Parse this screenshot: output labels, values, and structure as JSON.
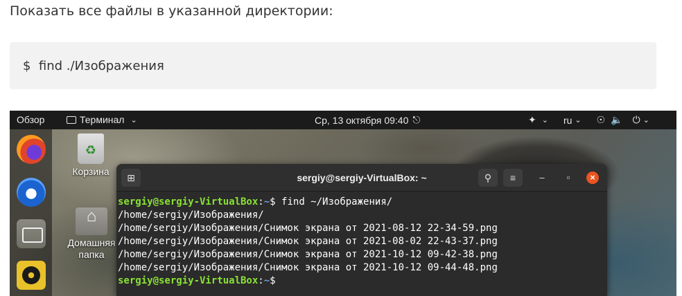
{
  "article": {
    "intro": "Показать все файлы в указанной директории:",
    "code": "$  find ./Изображения"
  },
  "topbar": {
    "overview": "Обзор",
    "app_name": "Терминал",
    "clock": "Ср, 13 октября  09:40",
    "lang": "ru"
  },
  "desktop": {
    "trash_label": "Корзина",
    "home_label": "Домашняя папка"
  },
  "terminal": {
    "title": "sergiy@sergiy-VirtualBox: ~",
    "prompt_user": "sergiy@sergiy-VirtualBox",
    "prompt_sep": ":",
    "prompt_path": "~",
    "prompt_end": "$ ",
    "command": "find ~/Изображения/",
    "output": [
      "/home/sergiy/Изображения/",
      "/home/sergiy/Изображения/Снимок экрана от 2021-08-12 22-34-59.png",
      "/home/sergiy/Изображения/Снимок экрана от 2021-08-02 22-43-37.png",
      "/home/sergiy/Изображения/Снимок экрана от 2021-10-12 09-42-38.png",
      "/home/sergiy/Изображения/Снимок экрана от 2021-10-12 09-44-48.png"
    ]
  },
  "colors": {
    "prompt_green": "#8ae234",
    "path_blue": "#729fcf",
    "close_orange": "#e95420",
    "topbar_bg": "#1b1b1b"
  }
}
